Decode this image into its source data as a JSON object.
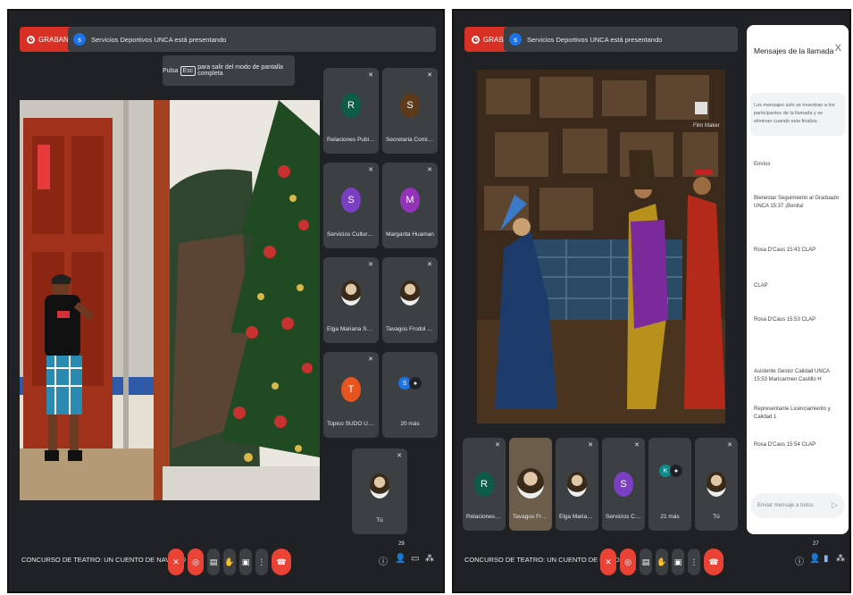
{
  "left": {
    "recording_label": "GRABANDO",
    "presenter_banner": "Servicios Deportivos UNCA está presentando",
    "toast": {
      "prefix": "Pulsa",
      "key": "Esc",
      "suffix": "para salir del modo de pantalla completa"
    },
    "tiles": [
      {
        "initial": "R",
        "name": "Relaciones Publicas...",
        "color": "#0d5c46"
      },
      {
        "initial": "S",
        "name": "Secretaria Comite Te...",
        "color": "#5d3a1a"
      },
      {
        "initial": "S",
        "name": "Servicios Culturales ...",
        "color": "#7b3fc4"
      },
      {
        "initial": "M",
        "name": "Margarita Huaman",
        "color": "#9334b8"
      },
      {
        "initial": "",
        "name": "Elga Mariana Sancha...",
        "color": "#5a4530"
      },
      {
        "initial": "",
        "name": "Tavagos Frodol Rach...",
        "color": "#6b5540"
      },
      {
        "initial": "T",
        "name": "Topico SUDO UNCA",
        "color": "#e8541e"
      },
      {
        "initial": "S",
        "name": "20 más",
        "color": "#1a73e8"
      },
      {
        "initial": "",
        "name": "Tú",
        "color": "#5a4530"
      }
    ],
    "meeting_title": "CONCURSO DE TEATRO: UN CUENTO DE NAVIDAD",
    "participant_count": "29"
  },
  "right": {
    "recording_label": "GRABANDO",
    "presenter_banner": "Servicios Deportivos UNCA está presentando",
    "video_overlay": "Film Maker",
    "tiles": [
      {
        "initial": "R",
        "name": "Relaciones Publi...",
        "color": "#0d5c46"
      },
      {
        "initial": "",
        "name": "Tavagos Frodol...",
        "color": "#6b5540"
      },
      {
        "initial": "",
        "name": "Elga Mariana San...",
        "color": "#5a4530"
      },
      {
        "initial": "S",
        "name": "Servicios Cultura...",
        "color": "#7b3fc4"
      },
      {
        "initial": "K",
        "name": "21 más",
        "color": "#0d8a8a"
      },
      {
        "initial": "",
        "name": "Tú",
        "color": "#5a4530"
      }
    ],
    "meeting_title": "CONCURSO DE TEATRO: UN CUENTO DE NAVIDAD",
    "participant_count": "27",
    "chat": {
      "title": "Mensajes de la llamada",
      "close": "X",
      "notice": "Los mensajes solo se muestran a los participantes de la llamada y se eliminan cuando esta finaliza",
      "messages": [
        {
          "text": "Envíos"
        },
        {
          "text": "Bienestar Seguimiento al Graduado UNCA 15:37 ¡Bonita!"
        },
        {
          "text": "Rosa D'Caus 15:43 CLAP"
        },
        {
          "text": "CLAP"
        },
        {
          "text": "Rosa D'Caus 15:53 CLAP"
        },
        {
          "text": "Asistente Gestor Calidad UNCA 15:53 Maricarmen Castillo H"
        },
        {
          "text": "Representante Licenciamiento y Calidad 1"
        },
        {
          "text": "Rosa D'Caus 15:54 CLAP"
        }
      ],
      "input_placeholder": "Enviar mensaje a todos"
    }
  }
}
